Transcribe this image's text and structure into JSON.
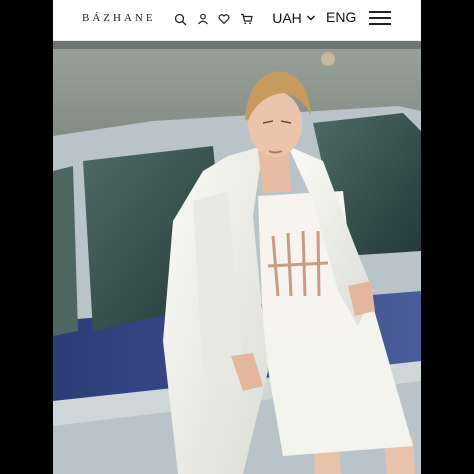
{
  "header": {
    "logo": "BÁZHANE",
    "currency": "UAH",
    "language": "ENG",
    "icons": [
      "search-icon",
      "user-icon",
      "heart-icon",
      "cart-icon",
      "chevron-down-icon",
      "menu-icon"
    ]
  },
  "hero": {
    "description_icon": "hero-photo"
  },
  "colors": {
    "page_background": "#000000",
    "header_background": "#ffffff",
    "text": "#111111",
    "car_blue": "#3b4e8a"
  }
}
